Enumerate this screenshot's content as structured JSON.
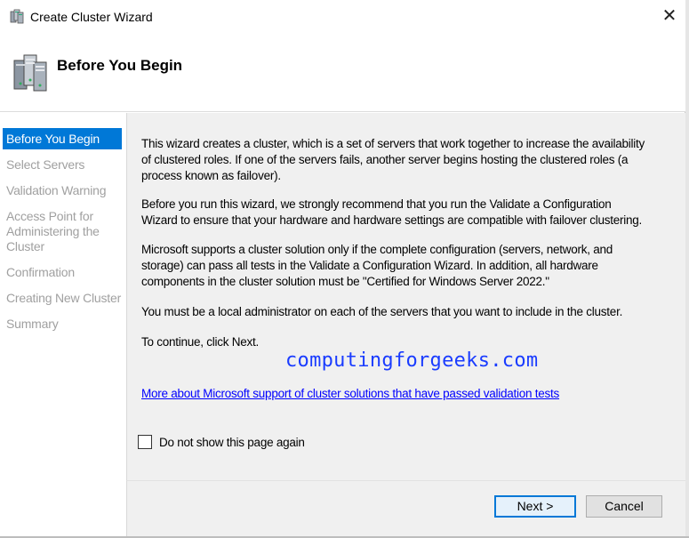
{
  "window": {
    "title": "Create Cluster Wizard",
    "close_glyph": "✕"
  },
  "header": {
    "title": "Before You Begin",
    "icon": "server-cluster-icon"
  },
  "sidebar": {
    "items": [
      {
        "label": "Before You Begin",
        "active": true
      },
      {
        "label": "Select Servers",
        "active": false
      },
      {
        "label": "Validation Warning",
        "active": false
      },
      {
        "label": "Access Point for Administering the Cluster",
        "active": false
      },
      {
        "label": "Confirmation",
        "active": false
      },
      {
        "label": "Creating New Cluster",
        "active": false
      },
      {
        "label": "Summary",
        "active": false
      }
    ]
  },
  "content": {
    "p1": "This wizard creates a cluster, which is a set of servers that work together to increase the availability of clustered roles. If one of the servers fails, another server begins hosting the clustered roles (a process known as failover).",
    "p2": "Before you run this wizard, we strongly recommend that you run the Validate a Configuration Wizard to ensure that your hardware and hardware settings are compatible with failover clustering.",
    "p3": "Microsoft supports a cluster solution only if the complete configuration (servers, network, and storage) can pass all tests in the Validate a Configuration Wizard. In addition, all hardware components in the cluster solution must be \"Certified for Windows Server 2022.\"",
    "p4": "You must be a local administrator on each of the servers that you want to include in the cluster.",
    "p5": "To continue, click Next.",
    "watermark": "computingforgeeks.com",
    "link": "More about Microsoft support of cluster solutions that have passed validation tests",
    "checkbox_label": "Do not show this page again",
    "checkbox_checked": false
  },
  "footer": {
    "next_label": "Next >",
    "cancel_label": "Cancel"
  },
  "colors": {
    "accent": "#0078d7",
    "link": "#0000ff",
    "watermark": "#1a3cff",
    "panel": "#f0f0f0"
  }
}
